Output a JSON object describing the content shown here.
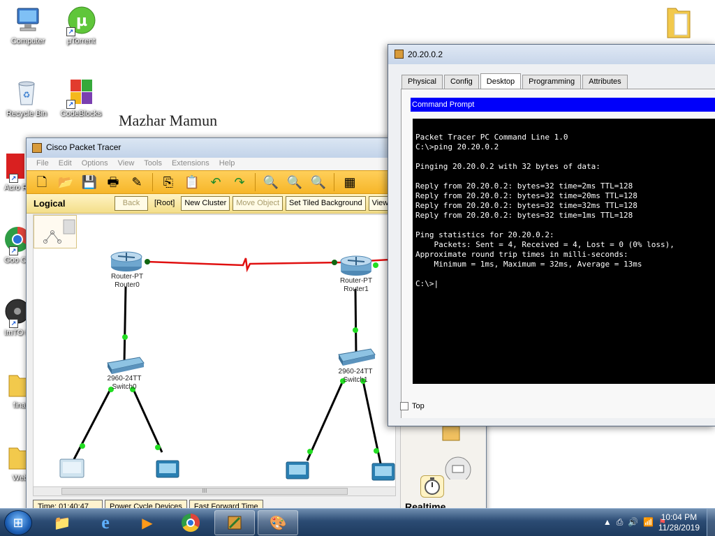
{
  "desktop": {
    "icons": [
      {
        "label": "Computer"
      },
      {
        "label": "µTorrent"
      },
      {
        "label": "Recycle Bin"
      },
      {
        "label": "CodeBlocks"
      },
      {
        "label": "Acro Read"
      },
      {
        "label": "Goo Chro"
      },
      {
        "label": "ImTO to MP"
      },
      {
        "label": "final"
      },
      {
        "label": "Web"
      }
    ],
    "signature": "Mazhar Mamun"
  },
  "packet_tracer": {
    "title": "Cisco Packet Tracer",
    "menu": [
      "File",
      "Edit",
      "Options",
      "View",
      "Tools",
      "Extensions",
      "Help"
    ],
    "logical_label": "Logical",
    "logical_buttons": [
      "Back",
      "[Root]",
      "New Cluster",
      "Move Object",
      "Set Tiled Background",
      "Viewpo"
    ],
    "devices": {
      "router0": {
        "model": "Router-PT",
        "name": "Router0"
      },
      "router1": {
        "model": "Router-PT",
        "name": "Router1"
      },
      "switch0": {
        "model": "2960-24TT",
        "name": "Switch0"
      },
      "switch1": {
        "model": "2960-24TT",
        "name": "Switch1"
      }
    },
    "scroll_thumb": "III",
    "status": {
      "time": "Time: 01:40:47",
      "power_cycle": "Power Cycle Devices",
      "fast_forward": "Fast Forward Time"
    },
    "mode": "Realtime"
  },
  "pc_dialog": {
    "title": "20.20.0.2",
    "tabs": [
      "Physical",
      "Config",
      "Desktop",
      "Programming",
      "Attributes"
    ],
    "active_tab": "Desktop",
    "app_header": "Command Prompt",
    "console_lines": [
      "Packet Tracer PC Command Line 1.0",
      "C:\\>ping 20.20.0.2",
      "",
      "Pinging 20.20.0.2 with 32 bytes of data:",
      "",
      "Reply from 20.20.0.2: bytes=32 time=2ms TTL=128",
      "Reply from 20.20.0.2: bytes=32 time=20ms TTL=128",
      "Reply from 20.20.0.2: bytes=32 time=32ms TTL=128",
      "Reply from 20.20.0.2: bytes=32 time=1ms TTL=128",
      "",
      "Ping statistics for 20.20.0.2:",
      "    Packets: Sent = 4, Received = 4, Lost = 0 (0% loss),",
      "Approximate round trip times in milli-seconds:",
      "    Minimum = 1ms, Maximum = 32ms, Average = 13ms",
      "",
      "C:\\>"
    ],
    "top_checkbox": "Top"
  },
  "taskbar": {
    "time": "10:04 PM",
    "date": "11/28/2019"
  },
  "colors": {
    "toolbar": "#f6b629",
    "link_serial": "#e01010",
    "link_ethernet": "#000000",
    "port_up": "#22dd22",
    "console_bg": "#000000",
    "cmd_header": "#0000fa"
  }
}
